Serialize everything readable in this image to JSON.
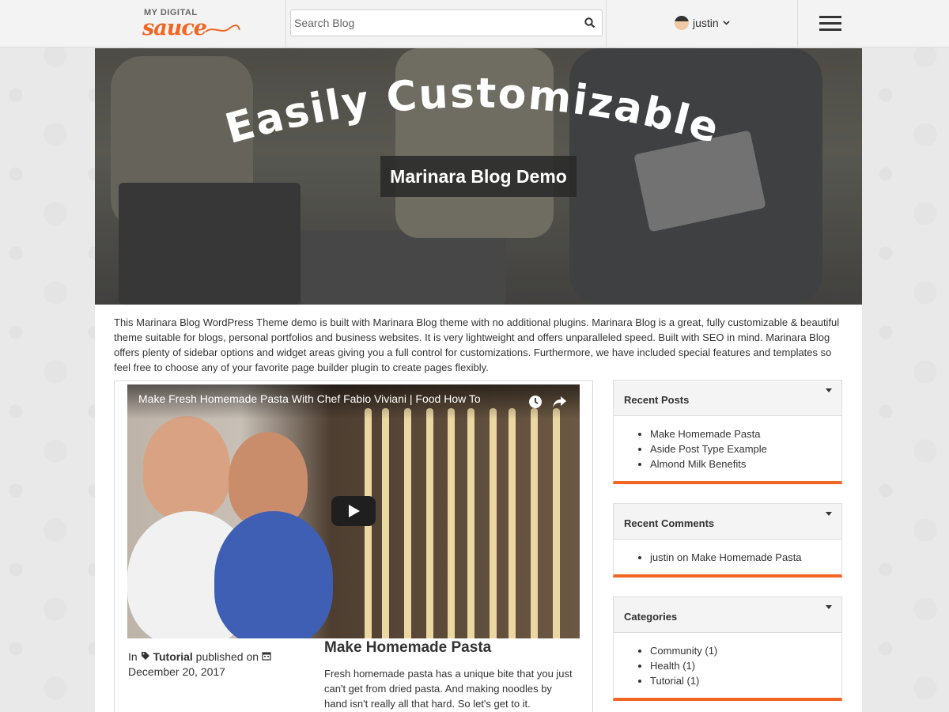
{
  "header": {
    "logo_small": "MY DIGITAL",
    "logo_big": "sauce",
    "search_placeholder": "Search Blog",
    "username": "justin"
  },
  "hero": {
    "title": "Easily Customizable",
    "subtitle": "Marinara Blog Demo"
  },
  "intro_text": "This Marinara Blog WordPress Theme demo is built with Marinara Blog theme with no additional plugins. Marinara Blog is a great, fully customizable & beautiful theme suitable for blogs, personal portfolios and business websites. It is very lightweight and offers unparalleled speed. Built with SEO in mind. Marinara Blog offers plenty of sidebar options and widget areas giving you a full control for customizations. Furthermore, we have included special features and templates so feel free to choose any of your favorite page builder plugin to create pages flexibly.",
  "post": {
    "video_title": "Make Fresh Homemade Pasta With Chef Fabio Viviani | Food How To",
    "meta_in": "In",
    "category": "Tutorial",
    "meta_published": "published on",
    "date": "December 20, 2017",
    "title": "Make Homemade Pasta",
    "excerpt": "Fresh homemade pasta has a unique bite that you just can't get from dried pasta. And making noodles by hand isn't really all that hard. So let's get to it."
  },
  "sidebar": {
    "recent_posts": {
      "title": "Recent Posts",
      "items": [
        "Make Homemade Pasta",
        "Aside Post Type Example",
        "Almond Milk Benefits"
      ]
    },
    "recent_comments": {
      "title": "Recent Comments",
      "author": "justin",
      "on": "on",
      "post": "Make Homemade Pasta"
    },
    "categories": {
      "title": "Categories",
      "items": [
        {
          "name": "Community",
          "count": "(1)"
        },
        {
          "name": "Health",
          "count": "(1)"
        },
        {
          "name": "Tutorial",
          "count": "(1)"
        }
      ]
    }
  },
  "colors": {
    "accent": "#f26522",
    "header_bg": "#f3f3f3",
    "text": "#333333"
  }
}
